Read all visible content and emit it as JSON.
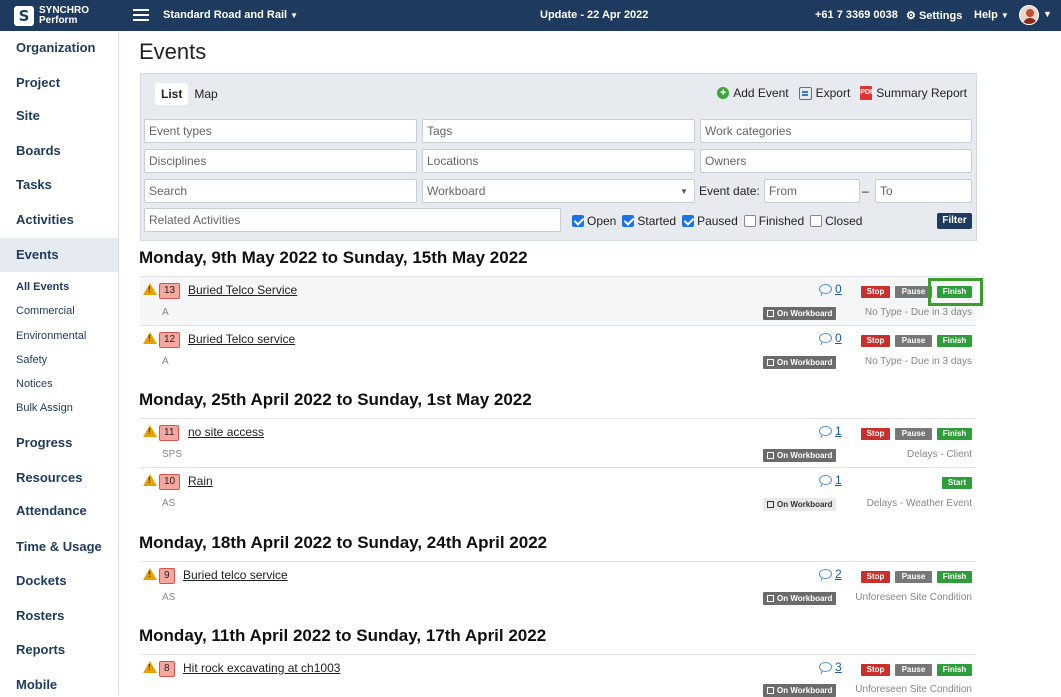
{
  "app": {
    "logo_line1": "SYNCHRO",
    "logo_line2": "Perform",
    "project": "Standard Road and Rail",
    "update": "Update - 22 Apr 2022",
    "phone": "+61 7 3369 0038",
    "settings": "Settings",
    "help": "Help",
    "accent": "#1f3a5f"
  },
  "sidebar": {
    "items": [
      "Organization",
      "Project",
      "Site",
      "Boards",
      "Tasks",
      "Activities",
      "Events",
      "Progress",
      "Resources",
      "Attendance",
      "Time & Usage",
      "Dockets",
      "Rosters",
      "Reports",
      "Mobile"
    ],
    "sub_items": [
      "All Events",
      "Commercial",
      "Environmental",
      "Safety",
      "Notices",
      "Bulk Assign"
    ]
  },
  "page": {
    "title": "Events"
  },
  "filters": {
    "tab_list": "List",
    "tab_map": "Map",
    "add_event": "Add Event",
    "export": "Export",
    "summary_report": "Summary Report",
    "event_types": "Event types",
    "tags": "Tags",
    "work_categories": "Work categories",
    "disciplines": "Disciplines",
    "locations": "Locations",
    "owners": "Owners",
    "search": "Search",
    "workboard": "Workboard",
    "event_date": "Event date:",
    "from": "From",
    "dash": "–",
    "to": "To",
    "related_activities": "Related Activities",
    "checkboxes": [
      {
        "label": "Open",
        "checked": true
      },
      {
        "label": "Started",
        "checked": true
      },
      {
        "label": "Paused",
        "checked": true
      },
      {
        "label": "Finished",
        "checked": false
      },
      {
        "label": "Closed",
        "checked": false
      }
    ],
    "filter_button": "Filter"
  },
  "labels": {
    "stop": "Stop",
    "pause": "Pause",
    "finish": "Finish",
    "start": "Start",
    "on_workboard": "On Workboard"
  },
  "weeks": [
    {
      "title": "Monday, 9th May 2022 to Sunday, 15th May 2022",
      "events": [
        {
          "num": "13",
          "title": "Buried Telco Service",
          "sub": "A",
          "comments": "0",
          "type": "No Type - Due in 3 days",
          "on_workboard": true,
          "actions": [
            "stop",
            "pause",
            "finish"
          ]
        },
        {
          "num": "12",
          "title": "Buried Telco service",
          "sub": "A",
          "comments": "0",
          "type": "No Type - Due in 3 days",
          "on_workboard": true,
          "actions": [
            "stop",
            "pause",
            "finish"
          ]
        }
      ]
    },
    {
      "title": "Monday, 25th April 2022 to Sunday, 1st May 2022",
      "events": [
        {
          "num": "11",
          "title": "no site access",
          "sub": "SPS",
          "comments": "1",
          "type": "Delays - Client",
          "on_workboard": true,
          "actions": [
            "stop",
            "pause",
            "finish"
          ]
        },
        {
          "num": "10",
          "title": "Rain",
          "sub": "AS",
          "comments": "1",
          "type": "Delays - Weather Event",
          "on_workboard": false,
          "actions": [
            "start"
          ]
        }
      ]
    },
    {
      "title": "Monday, 18th April 2022 to Sunday, 24th April 2022",
      "events": [
        {
          "num": "9",
          "title": "Buried telco service",
          "sub": "AS",
          "comments": "2",
          "type": "Unforeseen Site Condition",
          "on_workboard": true,
          "actions": [
            "stop",
            "pause",
            "finish"
          ]
        }
      ]
    },
    {
      "title": "Monday, 11th April 2022 to Sunday, 17th April 2022",
      "events": [
        {
          "num": "8",
          "title": "Hit rock excavating at ch1003",
          "sub": "",
          "comments": "3",
          "type": "Unforeseen Site Condition",
          "on_workboard": true,
          "actions": [
            "stop",
            "pause",
            "finish"
          ]
        }
      ]
    }
  ]
}
